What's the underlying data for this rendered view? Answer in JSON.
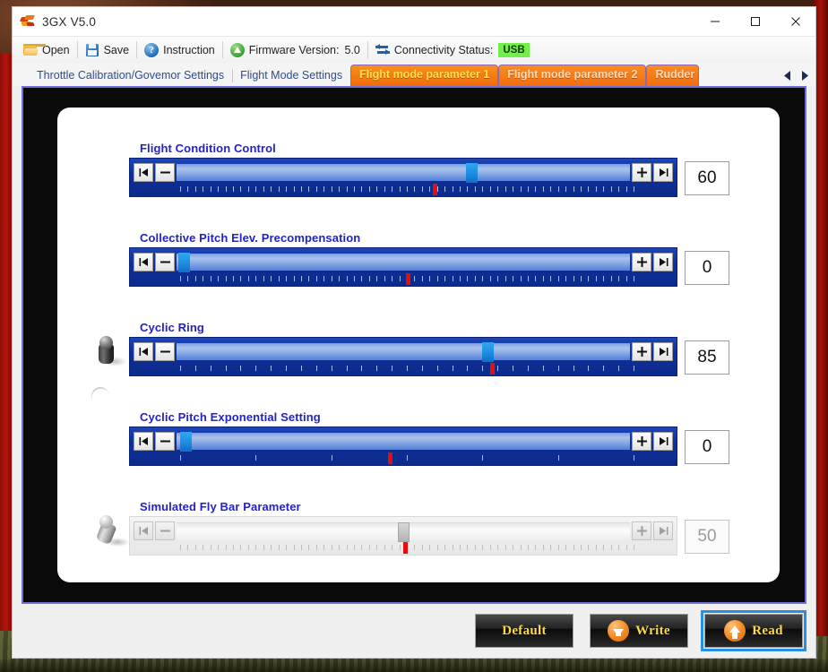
{
  "window": {
    "title": "3GX  V5.0",
    "app_icon": "3gx-logo-icon",
    "minimize": "minimize-icon",
    "maximize": "maximize-icon",
    "close": "close-icon"
  },
  "toolbar": {
    "open_label": "Open",
    "save_label": "Save",
    "instruction_label": "Instruction",
    "firmware_label": "Firmware Version:",
    "firmware_value": "5.0",
    "connectivity_label": "Connectivity Status:",
    "connectivity_value": "USB",
    "connectivity_badge_color": "#72f04a"
  },
  "tabs": [
    {
      "label": "Throttle Calibration/Govemor Settings",
      "style": "plain",
      "active": false
    },
    {
      "label": "Flight Mode Settings",
      "style": "plain",
      "active": false
    },
    {
      "label": "Flight mode parameter 1",
      "style": "orange",
      "active": true
    },
    {
      "label": "Flight mode parameter 2",
      "style": "orange",
      "active": false
    },
    {
      "label": "Rudder",
      "style": "orange",
      "active": false
    }
  ],
  "tab_nav": {
    "prev": "prev-arrow-icon",
    "next": "next-arrow-icon"
  },
  "slider_buttons": {
    "first": "skip-to-start-icon",
    "minus": "decrement-icon",
    "plus": "increment-icon",
    "last": "skip-to-end-icon"
  },
  "parameters": [
    {
      "label": "Flight Condition Control",
      "value": "60",
      "thumb_pct": 65.0,
      "marker_pct": 56.0,
      "tick_count": 60,
      "disabled": false,
      "knob": null
    },
    {
      "label": "Collective Pitch Elev. Precompensation",
      "value": "0",
      "thumb_pct": 1.5,
      "marker_pct": 50.0,
      "tick_count": 60,
      "disabled": false,
      "knob": null
    },
    {
      "label": "Cyclic Ring",
      "value": "85",
      "thumb_pct": 68.5,
      "marker_pct": 68.5,
      "tick_count": 30,
      "disabled": false,
      "knob": "joystick-upright-icon"
    },
    {
      "label": "Cyclic Pitch Exponential Setting",
      "value": "0",
      "thumb_pct": 2.0,
      "marker_pct": 46.0,
      "tick_count": 6,
      "disabled": false,
      "knob": null
    },
    {
      "label": "Simulated Fly Bar Parameter",
      "value": "50",
      "thumb_pct": 50.0,
      "marker_pct": 49.5,
      "tick_count": 60,
      "disabled": true,
      "knob": "joystick-tilted-icon"
    }
  ],
  "footer": {
    "default_label": "Default",
    "write_label": "Write",
    "read_label": "Read",
    "write_icon": "download-arrow-icon",
    "read_icon": "upload-arrow-icon",
    "focused_button": "Read"
  }
}
